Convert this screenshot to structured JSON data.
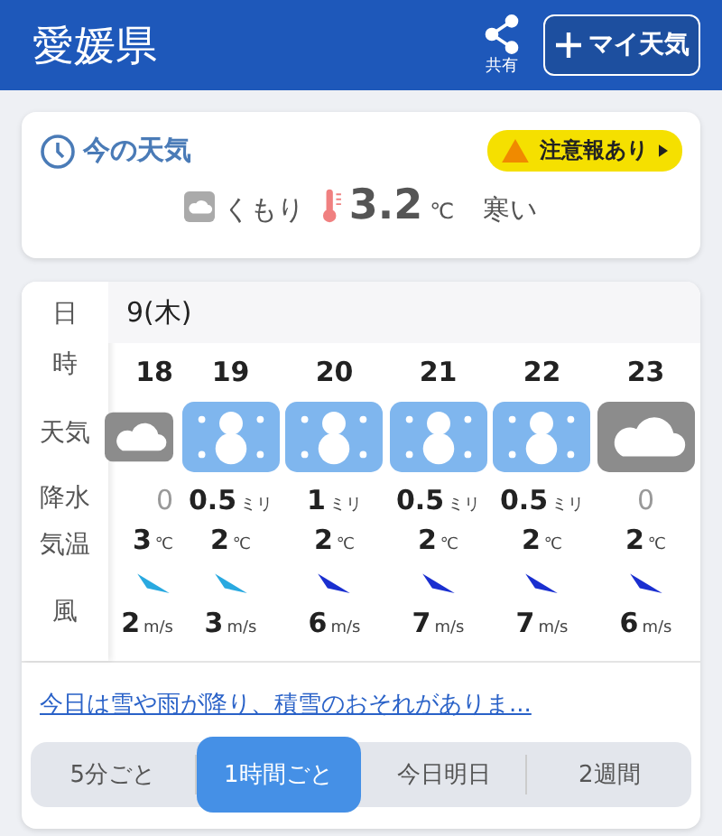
{
  "header": {
    "title": "愛媛県",
    "share_label": "共有",
    "my_weather_button": "マイ天気"
  },
  "current": {
    "title": "今の天気",
    "alert": "注意報あり",
    "kind": "cloudy",
    "weather": "くもり",
    "temperature": "3.2",
    "temperature_unit": "℃",
    "feeling": "寒い"
  },
  "forecast": {
    "row_labels": [
      "日",
      "時",
      "天気",
      "降水",
      "気温",
      "風"
    ],
    "date": "9(木)",
    "hours": [
      {
        "hour": "18",
        "kind": "cloudy",
        "precip": "0",
        "temp": "3",
        "temp_unit": "℃",
        "wind": "2",
        "wind_unit": "m/s",
        "color": "#29a9e0"
      },
      {
        "hour": "19",
        "kind": "snow",
        "precip": "0.5",
        "precip_unit": "ミリ",
        "temp": "2",
        "temp_unit": "℃",
        "wind": "3",
        "wind_unit": "m/s",
        "color": "#29a9e0"
      },
      {
        "hour": "20",
        "kind": "snow",
        "precip": "1",
        "precip_unit": "ミリ",
        "temp": "2",
        "temp_unit": "℃",
        "wind": "6",
        "wind_unit": "m/s",
        "color": "#1a2fd0"
      },
      {
        "hour": "21",
        "kind": "snow",
        "precip": "0.5",
        "precip_unit": "ミリ",
        "temp": "2",
        "temp_unit": "℃",
        "wind": "7",
        "wind_unit": "m/s",
        "color": "#1a2fd0"
      },
      {
        "hour": "22",
        "kind": "snow",
        "precip": "0.5",
        "precip_unit": "ミリ",
        "temp": "2",
        "temp_unit": "℃",
        "wind": "7",
        "wind_unit": "m/s",
        "color": "#1a2fd0"
      },
      {
        "hour": "23",
        "kind": "cloudy",
        "precip": "0",
        "temp": "2",
        "temp_unit": "℃",
        "wind": "6",
        "wind_unit": "m/s",
        "color": "#1a2fd0"
      }
    ],
    "summary_link": "今日は雪や雨が降り、積雪のおそれがありま...",
    "tabs": [
      {
        "label": "5分ごと",
        "selected": false
      },
      {
        "label": "1時間ごと",
        "selected": true
      },
      {
        "label": "今日明日",
        "selected": false
      },
      {
        "label": "2週間",
        "selected": false
      }
    ]
  }
}
